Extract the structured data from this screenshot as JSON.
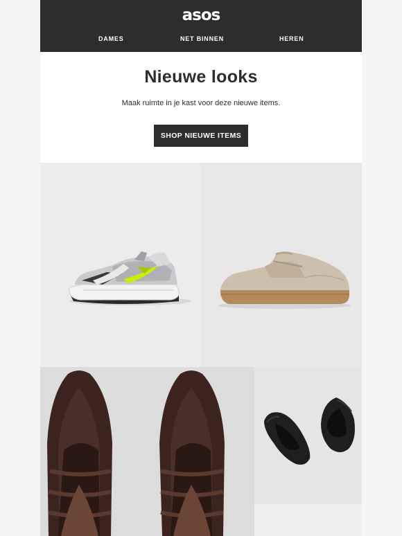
{
  "header": {
    "logo": "asos",
    "nav": [
      "DAMES",
      "NET BINNEN",
      "HEREN"
    ]
  },
  "hero": {
    "title": "Nieuwe looks",
    "subtitle": "Maak ruimte in je kast voor deze nieuwe items.",
    "cta_label": "SHOP NIEUWE ITEMS"
  },
  "products": [
    {
      "name": "sneaker",
      "bg": "#ececec"
    },
    {
      "name": "suede mule",
      "bg": "#e9e7e8"
    },
    {
      "name": "woven leather shoes",
      "bg": "#dcdcdc"
    },
    {
      "name": "black leather mule",
      "bg": "#e5e5e5"
    }
  ],
  "colors": {
    "header_bg": "#2d2d2d",
    "page_bg": "#f5f5f5",
    "accent_swoosh": "#c8f000"
  }
}
